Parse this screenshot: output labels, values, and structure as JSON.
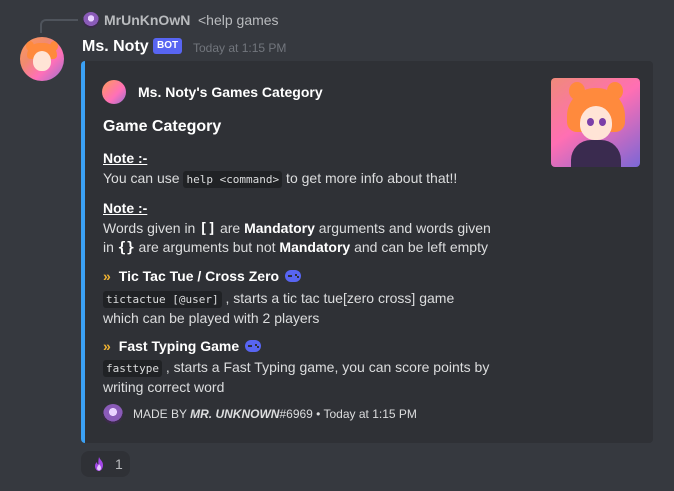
{
  "reply": {
    "username": "MrUnKnOwN",
    "text": "<help games"
  },
  "message": {
    "username": "Ms. Noty",
    "bot_tag": "BOT",
    "timestamp": "Today at 1:15 PM"
  },
  "embed": {
    "accent_color": "#3ba1f5",
    "author": "Ms. Noty's Games Category",
    "title": "Game Category",
    "note1": {
      "heading": "Note :-",
      "pre": "You can use ",
      "code": "help <command>",
      "post": " to get more info about that!!"
    },
    "note2": {
      "heading": "Note :-",
      "line1_a": "Words given in ",
      "line1_brackets": "[]",
      "line1_b": " are ",
      "line1_bold": "Mandatory",
      "line1_c": " arguments and words given",
      "line2_a": "in ",
      "line2_braces": "{}",
      "line2_b": " are arguments but not ",
      "line2_bold": "Mandatory",
      "line2_c": " and can be left empty"
    },
    "commands": [
      {
        "title": "Tic Tac Tue / Cross Zero",
        "code": "tictactue [@user]",
        "desc1": " , starts a tic tac tue[zero cross] game",
        "desc2": "which can be played with 2 players"
      },
      {
        "title": "Fast Typing Game",
        "code": "fasttype",
        "desc1": " , starts a Fast Typing game, you can score points by",
        "desc2": "writing correct word"
      }
    ],
    "footer": {
      "made_by": "MADE BY ",
      "author": "MR. UNKNOWN",
      "tag": "#6969",
      "separator": " • ",
      "time": "Today at 1:15 PM"
    }
  },
  "reaction": {
    "emoji": "purple-fire-emoji",
    "count": "1"
  }
}
